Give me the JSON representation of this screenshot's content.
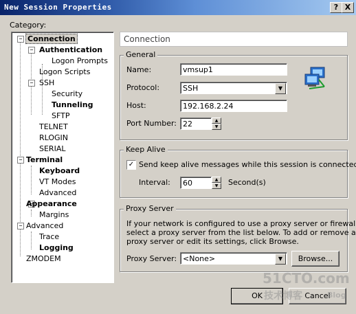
{
  "window": {
    "title": "New Session Properties",
    "help": "?",
    "close": "X"
  },
  "category_label": "Category:",
  "tree": {
    "connection": "Connection",
    "authentication": "Authentication",
    "logon_prompts": "Logon Prompts",
    "logon_scripts": "Logon Scripts",
    "ssh": "SSH",
    "security": "Security",
    "tunneling": "Tunneling",
    "sftp": "SFTP",
    "telnet": "TELNET",
    "rlogin": "RLOGIN",
    "serial": "SERIAL",
    "terminal": "Terminal",
    "keyboard": "Keyboard",
    "vt_modes": "VT Modes",
    "advanced_term": "Advanced",
    "appearance": "Appearance",
    "margins": "Margins",
    "advanced": "Advanced",
    "trace": "Trace",
    "logging": "Logging",
    "zmodem": "ZMODEM"
  },
  "panel_title": "Connection",
  "general": {
    "label": "General",
    "name_label": "Name:",
    "name_value": "vmsup1",
    "protocol_label": "Protocol:",
    "protocol_value": "SSH",
    "host_label": "Host:",
    "host_value": "192.168.2.24",
    "port_label": "Port Number:",
    "port_value": "22"
  },
  "keep_alive": {
    "label": "Keep Alive",
    "checkbox_label": "Send keep alive messages while this session is connected",
    "checked": true,
    "interval_label": "Interval:",
    "interval_value": "60",
    "unit": "Second(s)"
  },
  "proxy": {
    "label": "Proxy Server",
    "description_1": "If your network is configured to use a proxy server or firewall,",
    "description_2": "select a proxy server from the list below. To add or remove a",
    "description_3": "proxy server or edit its settings, click Browse.",
    "server_label": "Proxy Server:",
    "server_value": "<None>",
    "browse": "Browse..."
  },
  "buttons": {
    "ok": "OK",
    "cancel": "Cancel"
  },
  "watermark": {
    "line1": "51CTO.com",
    "line2": "技术博客",
    "line3": "Blog"
  }
}
